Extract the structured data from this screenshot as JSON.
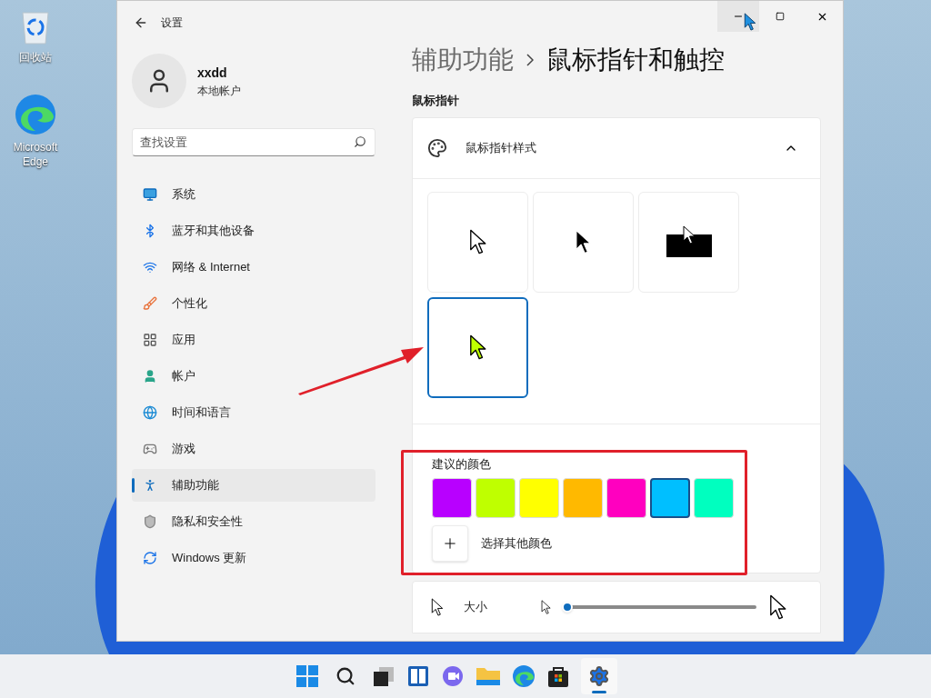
{
  "desktop_icons": [
    {
      "label": "回收站"
    },
    {
      "label": "Microsoft Edge"
    }
  ],
  "window": {
    "title": "设置"
  },
  "profile": {
    "name": "xxdd",
    "account_type": "本地帐户"
  },
  "search": {
    "placeholder": "查找设置"
  },
  "nav": [
    {
      "label": "系统",
      "selected": false
    },
    {
      "label": "蓝牙和其他设备",
      "selected": false
    },
    {
      "label": "网络 & Internet",
      "selected": false
    },
    {
      "label": "个性化",
      "selected": false
    },
    {
      "label": "应用",
      "selected": false
    },
    {
      "label": "帐户",
      "selected": false
    },
    {
      "label": "时间和语言",
      "selected": false
    },
    {
      "label": "游戏",
      "selected": false
    },
    {
      "label": "辅助功能",
      "selected": true
    },
    {
      "label": "隐私和安全性",
      "selected": false
    },
    {
      "label": "Windows 更新",
      "selected": false
    }
  ],
  "breadcrumb": {
    "parent": "辅助功能",
    "current": "鼠标指针和触控"
  },
  "section_title": "鼠标指针",
  "style_card": {
    "title": "鼠标指针样式",
    "expanded": true,
    "styles": [
      {
        "kind": "white",
        "selected": false
      },
      {
        "kind": "black",
        "selected": false
      },
      {
        "kind": "inverted",
        "selected": false
      },
      {
        "kind": "custom",
        "selected": true
      }
    ],
    "colors_title": "建议的颜色",
    "colors": [
      {
        "color": "#b800ff",
        "selected": false
      },
      {
        "color": "#bfff00",
        "selected": false
      },
      {
        "color": "#ffff00",
        "selected": false
      },
      {
        "color": "#ffb900",
        "selected": false
      },
      {
        "color": "#ff00bf",
        "selected": false
      },
      {
        "color": "#00bfff",
        "selected": true
      },
      {
        "color": "#00ffbf",
        "selected": false
      }
    ],
    "custom_color_label": "选择其他颜色"
  },
  "size": {
    "label": "大小",
    "level": 0.02
  }
}
